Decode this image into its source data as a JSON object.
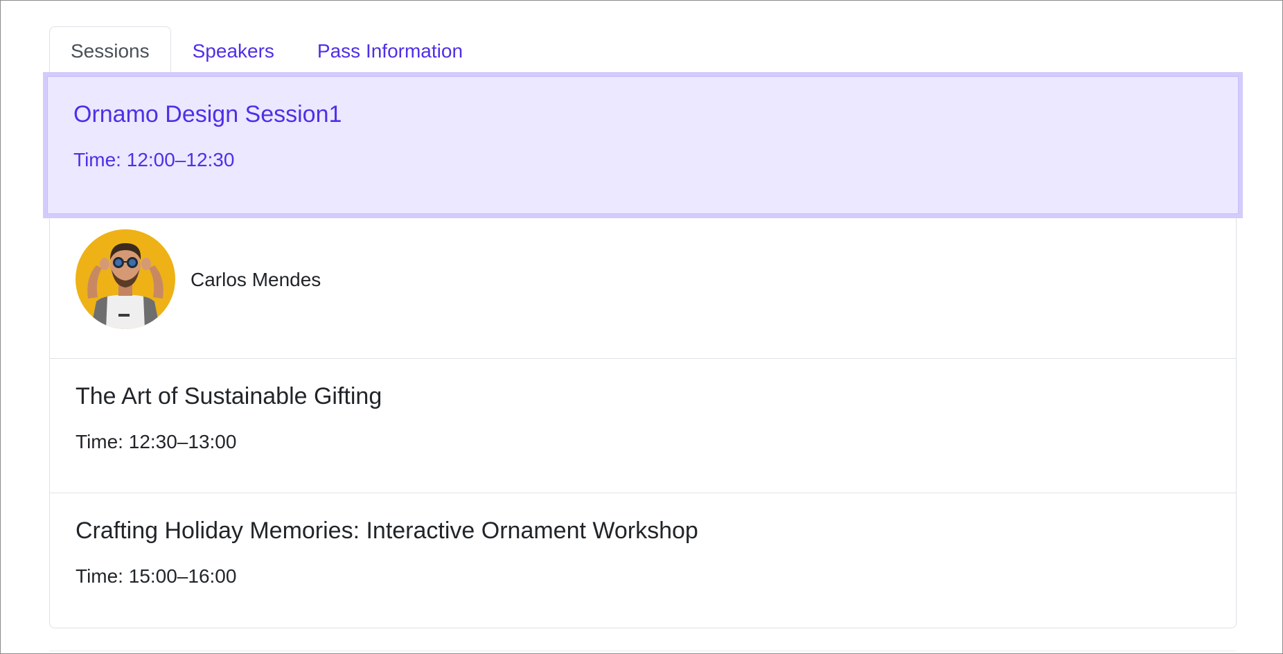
{
  "tabs": [
    {
      "label": "Sessions",
      "active": true
    },
    {
      "label": "Speakers",
      "active": false
    },
    {
      "label": "Pass Information",
      "active": false
    }
  ],
  "sessions": [
    {
      "title": "Ornamo Design Session1",
      "time": "Time: 12:00–12:30",
      "selected": true
    },
    {
      "title": "The Art of Sustainable Gifting",
      "time": "Time: 12:30–13:00",
      "selected": false
    },
    {
      "title": "Crafting Holiday Memories: Interactive Ornament Workshop",
      "time": "Time: 15:00–16:00",
      "selected": false
    }
  ],
  "speaker": {
    "name": "Carlos Mendes",
    "avatar_icon": "speaker-avatar-photo"
  },
  "colors": {
    "accent": "#4f2fe6",
    "selected_bg": "#ebe8ff",
    "selected_ring": "#d3ccfb",
    "border": "#dee2e6",
    "text": "#212529",
    "tab_active_text": "#495057"
  }
}
